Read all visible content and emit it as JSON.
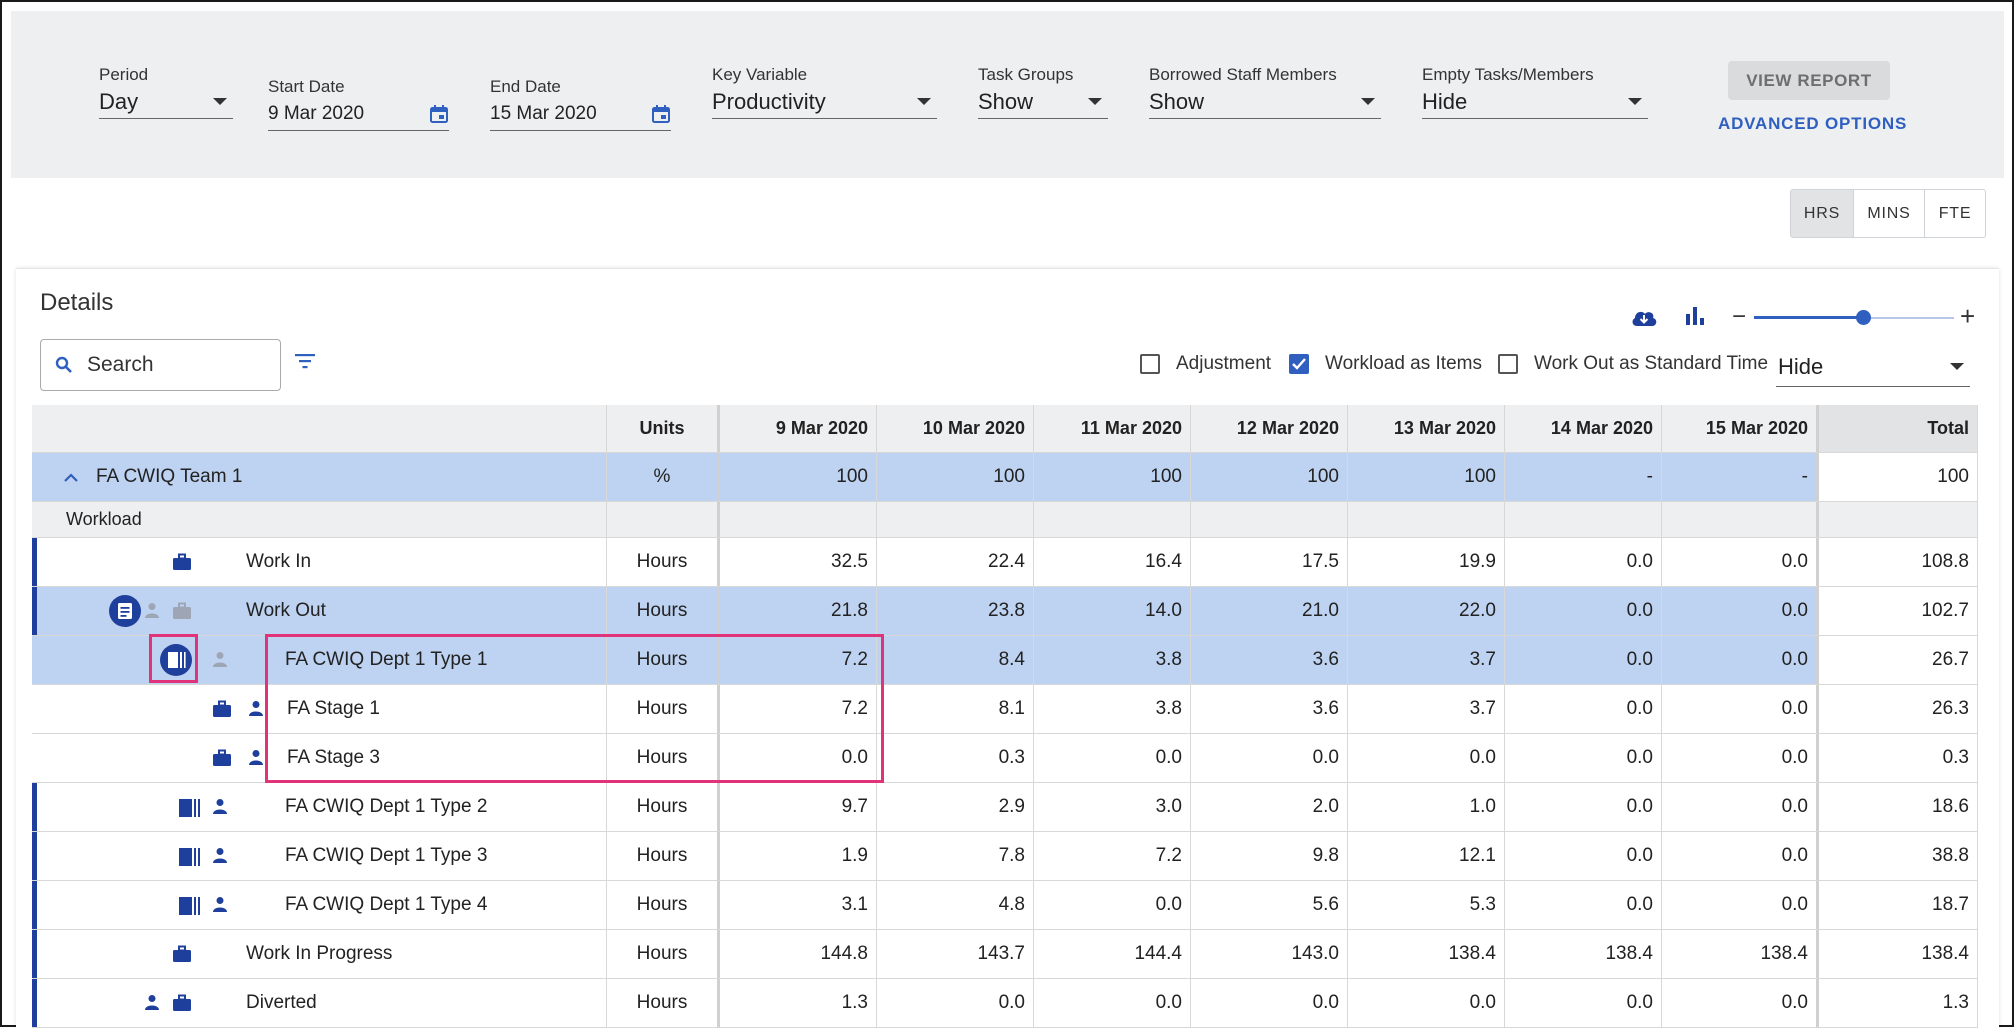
{
  "filters": {
    "period": {
      "label": "Period",
      "value": "Day"
    },
    "start_date": {
      "label": "Start Date",
      "value": "9 Mar 2020"
    },
    "end_date": {
      "label": "End Date",
      "value": "15 Mar 2020"
    },
    "key_variable": {
      "label": "Key Variable",
      "value": "Productivity"
    },
    "task_groups": {
      "label": "Task Groups",
      "value": "Show"
    },
    "borrowed_staff": {
      "label": "Borrowed Staff Members",
      "value": "Show"
    },
    "empty_tasks": {
      "label": "Empty Tasks/Members",
      "value": "Hide"
    },
    "view_report": "VIEW REPORT",
    "advanced_options": "ADVANCED OPTIONS"
  },
  "unit_toggle": {
    "hrs": "HRS",
    "mins": "MINS",
    "fte": "FTE",
    "selected": "HRS"
  },
  "details": {
    "title": "Details",
    "search_placeholder": "Search",
    "adjustment": "Adjustment",
    "workload_as_items": "Workload as Items",
    "work_out_standard": "Work Out as Standard Time",
    "hide_select": "Hide",
    "checkboxes": {
      "adjustment": false,
      "workload_as_items": true,
      "work_out_standard": false
    }
  },
  "table": {
    "headers": {
      "units": "Units",
      "total": "Total",
      "dates": [
        "9 Mar 2020",
        "10 Mar 2020",
        "11 Mar 2020",
        "12 Mar 2020",
        "13 Mar 2020",
        "14 Mar 2020",
        "15 Mar 2020"
      ]
    },
    "team_row": {
      "name": "FA CWIQ Team 1",
      "units": "%",
      "values": [
        "100",
        "100",
        "100",
        "100",
        "100",
        "-",
        "-"
      ],
      "total": "100"
    },
    "section_label": "Workload",
    "rows": [
      {
        "name": "Work In",
        "units": "Hours",
        "values": [
          "32.5",
          "22.4",
          "16.4",
          "17.5",
          "19.9",
          "0.0",
          "0.0"
        ],
        "total": "108.8"
      },
      {
        "name": "Work Out",
        "units": "Hours",
        "values": [
          "21.8",
          "23.8",
          "14.0",
          "21.0",
          "22.0",
          "0.0",
          "0.0"
        ],
        "total": "102.7"
      },
      {
        "name": "FA CWIQ Dept 1 Type 1",
        "units": "Hours",
        "values": [
          "7.2",
          "8.4",
          "3.8",
          "3.6",
          "3.7",
          "0.0",
          "0.0"
        ],
        "total": "26.7"
      },
      {
        "name": "FA Stage 1",
        "units": "Hours",
        "values": [
          "7.2",
          "8.1",
          "3.8",
          "3.6",
          "3.7",
          "0.0",
          "0.0"
        ],
        "total": "26.3"
      },
      {
        "name": "FA Stage 3",
        "units": "Hours",
        "values": [
          "0.0",
          "0.3",
          "0.0",
          "0.0",
          "0.0",
          "0.0",
          "0.0"
        ],
        "total": "0.3"
      },
      {
        "name": "FA CWIQ Dept 1 Type 2",
        "units": "Hours",
        "values": [
          "9.7",
          "2.9",
          "3.0",
          "2.0",
          "1.0",
          "0.0",
          "0.0"
        ],
        "total": "18.6"
      },
      {
        "name": "FA CWIQ Dept 1 Type 3",
        "units": "Hours",
        "values": [
          "1.9",
          "7.8",
          "7.2",
          "9.8",
          "12.1",
          "0.0",
          "0.0"
        ],
        "total": "38.8"
      },
      {
        "name": "FA CWIQ Dept 1 Type 4",
        "units": "Hours",
        "values": [
          "3.1",
          "4.8",
          "0.0",
          "5.6",
          "5.3",
          "0.0",
          "0.0"
        ],
        "total": "18.7"
      },
      {
        "name": "Work In Progress",
        "units": "Hours",
        "values": [
          "144.8",
          "143.7",
          "144.4",
          "143.0",
          "138.4",
          "138.4",
          "138.4"
        ],
        "total": "138.4"
      },
      {
        "name": "Diverted",
        "units": "Hours",
        "values": [
          "1.3",
          "0.0",
          "0.0",
          "0.0",
          "0.0",
          "0.0",
          "0.0"
        ],
        "total": "1.3"
      }
    ]
  },
  "colors": {
    "accent": "#2f5fbf",
    "row_highlight": "#bed2f1",
    "annotation": "#e0337a",
    "icon_navy": "#1f3f9c"
  }
}
